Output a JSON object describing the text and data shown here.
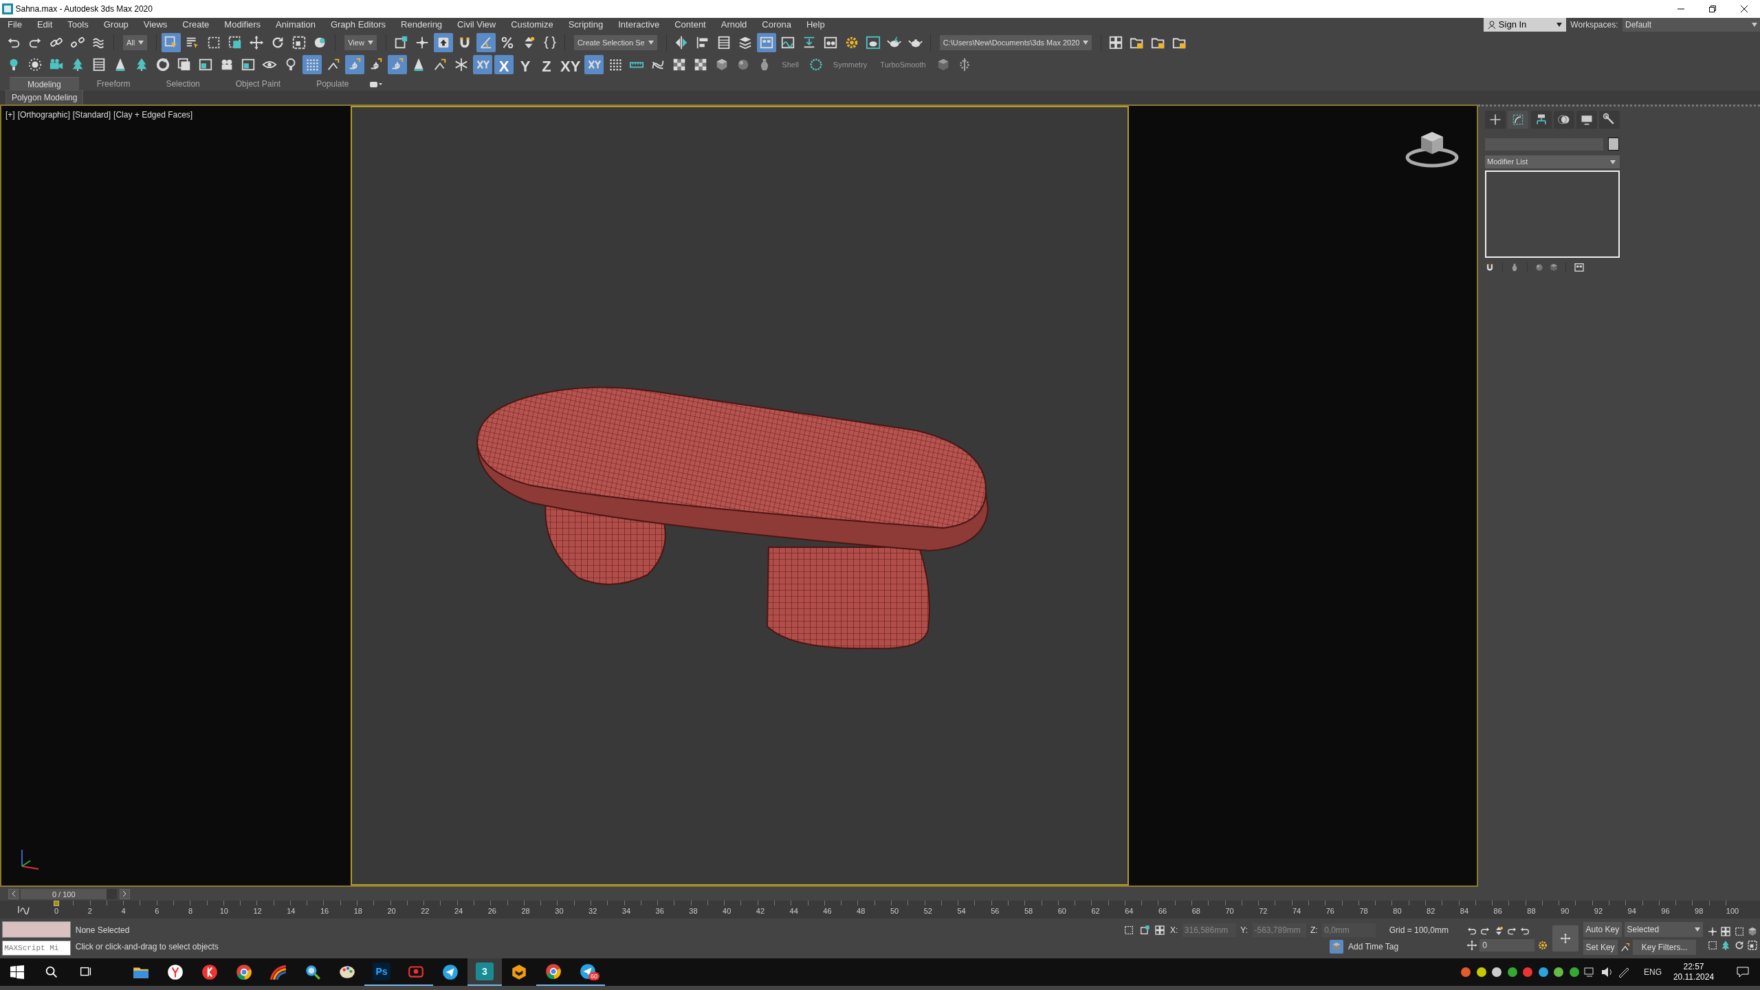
{
  "title_bar": {
    "title": "Sahna.max - Autodesk 3ds Max 2020"
  },
  "menu_bar": {
    "items": [
      "File",
      "Edit",
      "Tools",
      "Group",
      "Views",
      "Create",
      "Modifiers",
      "Animation",
      "Graph Editors",
      "Rendering",
      "Civil View",
      "Customize",
      "Scripting",
      "Interactive",
      "Content",
      "Arnold",
      "Corona",
      "Help"
    ],
    "sign_in": "Sign In",
    "workspaces_label": "Workspaces:",
    "workspace": "Default"
  },
  "main_toolbar": [
    {
      "kind": "button",
      "selected": false
    },
    {
      "kind": "button",
      "selected": false
    },
    {
      "kind": "button",
      "selected": false
    },
    {
      "kind": "button",
      "selected": false
    },
    {
      "kind": "button",
      "selected": false
    },
    {
      "kind": "dropdown",
      "value": "All"
    },
    {
      "kind": "button",
      "selected": true
    },
    {
      "kind": "button",
      "selected": false
    },
    {
      "kind": "button",
      "selected": false
    },
    {
      "kind": "button",
      "selected": false
    },
    {
      "kind": "button",
      "selected": false
    },
    {
      "kind": "button",
      "selected": false
    },
    {
      "kind": "button",
      "selected": false
    },
    {
      "kind": "button",
      "selected": false
    },
    {
      "kind": "dropdown",
      "value": "View"
    },
    {
      "kind": "button",
      "selected": false
    },
    {
      "kind": "button",
      "selected": false
    },
    {
      "kind": "button",
      "selected": true
    },
    {
      "kind": "button",
      "selected": false
    },
    {
      "kind": "button",
      "selected": true
    },
    {
      "kind": "button",
      "selected": false
    },
    {
      "kind": "button",
      "selected": false
    },
    {
      "kind": "button",
      "selected": false
    },
    {
      "kind": "dropdown",
      "value": "Create Selection Se"
    },
    {
      "kind": "button",
      "selected": false
    },
    {
      "kind": "button",
      "selected": false
    },
    {
      "kind": "button",
      "selected": false
    },
    {
      "kind": "button",
      "selected": false
    },
    {
      "kind": "button",
      "selected": true
    },
    {
      "kind": "button",
      "selected": false
    },
    {
      "kind": "button",
      "selected": false
    },
    {
      "kind": "button",
      "selected": false
    },
    {
      "kind": "button",
      "selected": false
    },
    {
      "kind": "button",
      "selected": false
    },
    {
      "kind": "button",
      "selected": false
    },
    {
      "kind": "button",
      "selected": false
    },
    {
      "kind": "dropdown",
      "value": "C:\\Users\\New\\Documents\\3ds Max 2020"
    },
    {
      "kind": "button",
      "selected": false
    },
    {
      "kind": "button",
      "selected": false
    },
    {
      "kind": "button",
      "selected": false
    },
    {
      "kind": "button",
      "selected": false
    }
  ],
  "second_toolbar": [
    {
      "kind": "button",
      "selected": false
    },
    {
      "kind": "button",
      "selected": false
    },
    {
      "kind": "button",
      "selected": false
    },
    {
      "kind": "button",
      "selected": false
    },
    {
      "kind": "button",
      "selected": false
    },
    {
      "kind": "button",
      "selected": false
    },
    {
      "kind": "button",
      "selected": false
    },
    {
      "kind": "button",
      "selected": false
    },
    {
      "kind": "button",
      "selected": false
    },
    {
      "kind": "button",
      "selected": false
    },
    {
      "kind": "button",
      "selected": false
    },
    {
      "kind": "button",
      "selected": false
    },
    {
      "kind": "button",
      "selected": false
    },
    {
      "kind": "button",
      "selected": false
    },
    {
      "kind": "button",
      "selected": true
    },
    {
      "kind": "button",
      "selected": false
    },
    {
      "kind": "button",
      "selected": true
    },
    {
      "kind": "button",
      "selected": false
    },
    {
      "kind": "button",
      "selected": true
    },
    {
      "kind": "button",
      "selected": false
    },
    {
      "kind": "button",
      "selected": false
    },
    {
      "kind": "button",
      "selected": false
    },
    {
      "kind": "button",
      "selected": true
    },
    {
      "kind": "text_button",
      "label": "X",
      "selected": true
    },
    {
      "kind": "text_button",
      "label": "Y",
      "selected": false
    },
    {
      "kind": "text_button",
      "label": "Z",
      "selected": false
    },
    {
      "kind": "text_button",
      "label": "XY",
      "selected": false
    },
    {
      "kind": "button",
      "selected": true
    },
    {
      "kind": "button",
      "selected": false
    },
    {
      "kind": "button",
      "selected": false
    },
    {
      "kind": "button",
      "selected": false
    },
    {
      "kind": "button",
      "selected": false
    },
    {
      "kind": "button",
      "selected": false
    },
    {
      "kind": "button",
      "selected": false
    },
    {
      "kind": "button",
      "selected": false
    },
    {
      "kind": "button",
      "selected": false
    },
    {
      "kind": "label",
      "text": "Shell"
    },
    {
      "kind": "button",
      "selected": false
    },
    {
      "kind": "label",
      "text": "Symmetry"
    },
    {
      "kind": "label",
      "text": "TurboSmooth"
    },
    {
      "kind": "button",
      "selected": false
    },
    {
      "kind": "button",
      "selected": false
    }
  ],
  "ribbon": {
    "tabs": [
      {
        "label": "Modeling",
        "selected": true
      },
      {
        "label": "Freeform",
        "selected": false
      },
      {
        "label": "Selection",
        "selected": false
      },
      {
        "label": "Object Paint",
        "selected": false
      },
      {
        "label": "Populate",
        "selected": false
      }
    ],
    "panel": "Polygon Modeling"
  },
  "viewport": {
    "labels": [
      "[+]",
      "[Orthographic]",
      "[Standard]",
      "[Clay + Edged Faces]"
    ]
  },
  "command_panel": {
    "tabs": [
      {
        "selected": false
      },
      {
        "selected": true
      },
      {
        "selected": false
      },
      {
        "selected": false
      },
      {
        "selected": false
      },
      {
        "selected": false
      }
    ],
    "modifier_list": "Modifier List"
  },
  "time_slider": {
    "position": "0 / 100",
    "level": 0
  },
  "track_bar": {
    "ticks": [
      "0",
      "2",
      "4",
      "6",
      "8",
      "10",
      "12",
      "14",
      "16",
      "18",
      "20",
      "22",
      "24",
      "26",
      "28",
      "30",
      "32",
      "34",
      "36",
      "38",
      "40",
      "42",
      "44",
      "46",
      "48",
      "50",
      "52",
      "54",
      "56",
      "58",
      "60",
      "62",
      "64",
      "66",
      "68",
      "70",
      "72",
      "74",
      "76",
      "78",
      "80",
      "82",
      "84",
      "86",
      "88",
      "90",
      "92",
      "94",
      "96",
      "98",
      "100"
    ]
  },
  "status": {
    "maxscript": "MAXScript Mi",
    "selection": "None Selected",
    "prompt": "Click or click-and-drag to select objects",
    "x_label": "X:",
    "x": "316,586mm",
    "y_label": "Y:",
    "y": "-563,789mm",
    "z_label": "Z:",
    "z": "0,0mm",
    "grid": "Grid = 100,0mm",
    "add_time_tag": "Add Time Tag",
    "frame": "0",
    "auto_key": "Auto Key",
    "key_mode": "Selected",
    "set_key": "Set Key",
    "key_filters": "Key Filters..."
  },
  "taskbar": {
    "apps": [
      {
        "running": false,
        "active": false
      },
      {
        "running": false,
        "active": false
      },
      {
        "running": false,
        "active": false
      },
      {
        "running": false,
        "active": false
      },
      {
        "running": false,
        "active": false
      },
      {
        "running": false,
        "active": false
      },
      {
        "running": false,
        "active": false
      },
      {
        "label": "Ps",
        "running": true,
        "active": false
      },
      {
        "running": true,
        "active": false
      },
      {
        "running": false,
        "active": false
      },
      {
        "label": "3",
        "running": true,
        "active": true
      },
      {
        "running": false,
        "active": false
      },
      {
        "running": true,
        "active": false
      },
      {
        "badge": "60",
        "running": true,
        "active": false
      }
    ],
    "language": "ENG",
    "time": "22:57",
    "date": "20.11.2024"
  }
}
